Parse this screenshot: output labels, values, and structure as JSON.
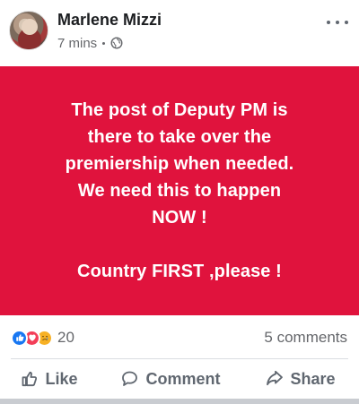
{
  "post": {
    "author": "Marlene Mizzi",
    "time": "7 mins",
    "privacy_icon": "globe-icon",
    "more_icon": "more-options-icon",
    "text_lines": [
      "The post of Deputy PM is",
      "there to take over the",
      "premiership when needed.",
      "We need this to happen",
      "NOW !",
      "",
      "Country FIRST ,please !"
    ],
    "background_color": "#e0133d",
    "text_color": "#ffffff"
  },
  "stats": {
    "reaction_icons": [
      "like-reaction-icon",
      "love-reaction-icon",
      "sad-reaction-icon"
    ],
    "reaction_count": "20",
    "comments": "5 comments"
  },
  "actions": {
    "like": "Like",
    "comment": "Comment",
    "share": "Share"
  },
  "colors": {
    "like_blue": "#1877f2",
    "love_red": "#f33e58",
    "sad_yellow": "#f7b125",
    "muted_text": "#65676b"
  }
}
